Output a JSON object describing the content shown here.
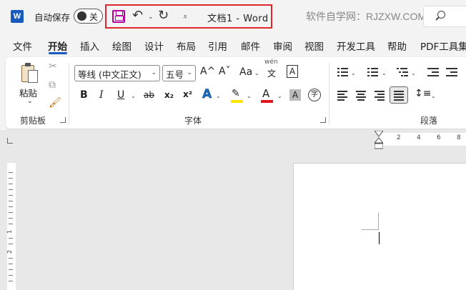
{
  "titlebar": {
    "app_icon_letter": "W",
    "autosave_label": "自动保存",
    "autosave_state": "关",
    "document_title": "文档1  -  Word",
    "site_watermark": "软件自学网：RJZXW.COM"
  },
  "tabs": [
    "文件",
    "开始",
    "插入",
    "绘图",
    "设计",
    "布局",
    "引用",
    "邮件",
    "审阅",
    "视图",
    "开发工具",
    "帮助",
    "PDF工具集"
  ],
  "active_tab": "开始",
  "ribbon": {
    "clipboard": {
      "paste_label": "粘贴",
      "group_label": "剪贴板"
    },
    "font": {
      "font_name": "等线 (中文正文)",
      "font_size": "五号",
      "grow_label": "A^",
      "shrink_label": "Aˇ",
      "case_label": "Aa",
      "phonetic_top": "wén",
      "phonetic_bottom": "文",
      "border_char": "A",
      "bold": "B",
      "italic": "I",
      "underline": "U",
      "strike": "ab",
      "subscript": "x₂",
      "superscript": "x²",
      "text_effect": "A",
      "font_color": "A",
      "char_shading": "A",
      "enclose": "字",
      "group_label": "字体"
    },
    "paragraph": {
      "group_label": "段落"
    }
  },
  "ruler": {
    "h_numbers": [
      "2",
      "4",
      "6",
      "8"
    ],
    "v_numbers": [
      "1",
      "2"
    ]
  },
  "colors": {
    "accent": "#185abd",
    "highlight_box": "#e0262d",
    "save_icon": "#b4009e",
    "highlight_yellow": "#ffe600",
    "font_red": "#e3151a"
  }
}
